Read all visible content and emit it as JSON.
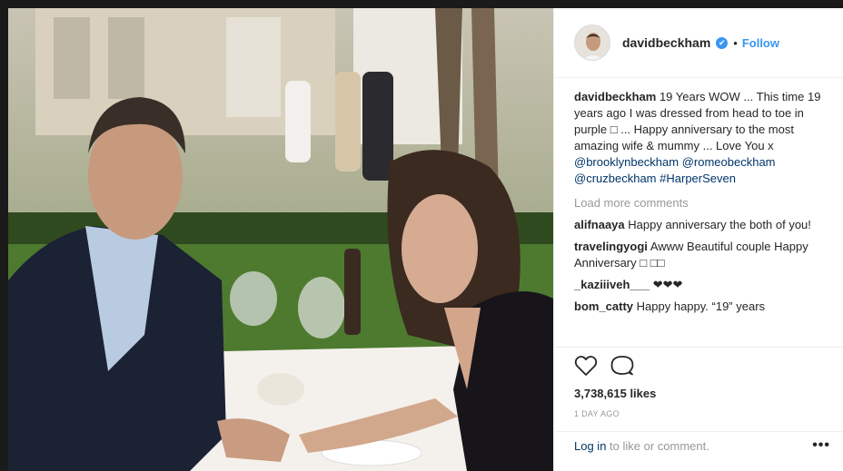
{
  "post": {
    "username": "davidbeckham",
    "follow_label": "Follow",
    "dot": "•",
    "verified_icon": "✔",
    "caption": {
      "username": "davidbeckham",
      "text": " 19 Years WOW ... This time 19 years ago I was dressed from head to toe in purple □ ... Happy anniversary to the most amazing wife & mummy ... Love You x ",
      "tags": [
        "@brooklynbeckham",
        "@romeobeckham",
        "@cruzbeckham",
        "#HarperSeven"
      ]
    },
    "load_more": "Load more comments",
    "comments": [
      {
        "user": "alifnaaya",
        "text": " Happy anniversary the both of you!"
      },
      {
        "user": "travelingyogi",
        "text": " Awww Beautiful couple Happy Anniversary □ □□"
      },
      {
        "user": "_kaziiiveh___",
        "text": " ❤❤❤"
      },
      {
        "user": "bom_catty",
        "text": " Happy happy. “19” years"
      }
    ],
    "likes": "3,738,615 likes",
    "time": "1 DAY AGO",
    "login_link": "Log in",
    "login_rest": " to like or comment.",
    "more_label": "•••"
  },
  "colors": {
    "link": "#003569",
    "follow": "#3897f0",
    "muted": "#999999"
  },
  "icons": [
    "verified-icon",
    "heart-icon",
    "comment-icon",
    "more-options-icon"
  ]
}
